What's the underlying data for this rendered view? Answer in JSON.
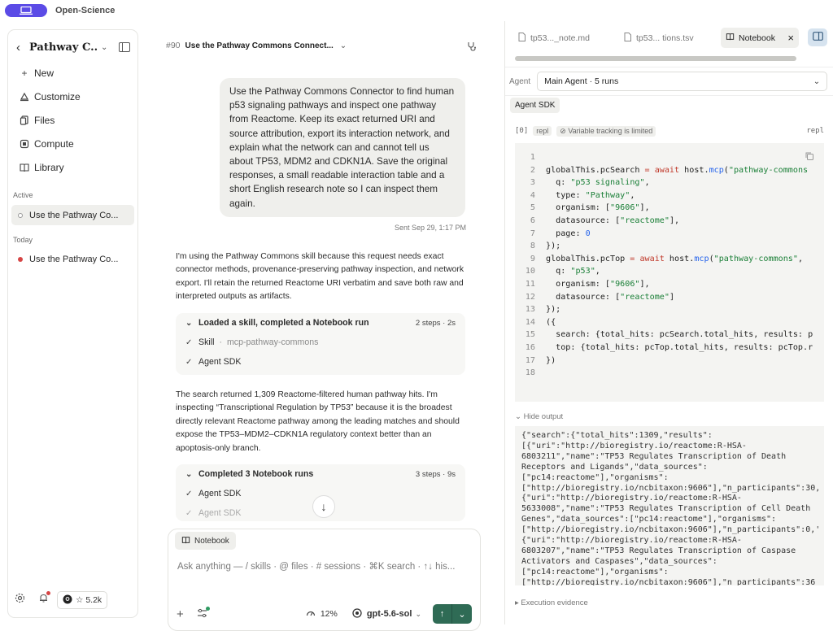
{
  "app": {
    "name": "Open-Science"
  },
  "sidebar": {
    "title": "Pathway C...",
    "nav": [
      {
        "label": "New",
        "icon": "plus-icon"
      },
      {
        "label": "Customize",
        "icon": "palette-icon"
      },
      {
        "label": "Files",
        "icon": "files-icon"
      },
      {
        "label": "Compute",
        "icon": "compute-icon"
      },
      {
        "label": "Library",
        "icon": "book-icon"
      }
    ],
    "active_label": "Active",
    "active_thread": "Use the Pathway Co...",
    "today_label": "Today",
    "today_thread": "Use the Pathway Co...",
    "github_stars": "☆ 5.2k",
    "status_color": "#d64545"
  },
  "chat": {
    "number": "#90",
    "title": "Use the Pathway Commons Connect...",
    "user_message": "Use the Pathway Commons Connector to find human p53 signaling pathways and inspect one pathway from Reactome. Keep its exact returned URI and source attribution, export its interaction network, and explain what the network can and cannot tell us about TP53, MDM2 and CDKN1A. Save the original responses, a small readable interaction table and a short English research note so I can inspect them again.",
    "sent": "Sent Sep 29, 1:17 PM",
    "assistant_1": "I'm using the Pathway Commons skill because this request needs exact connector methods, provenance-preserving pathway inspection, and network export. I'll retain the returned Reactome URI verbatim and save both raw and interpreted outputs as artifacts.",
    "steps_1": {
      "title": "Loaded a skill, completed a Notebook run",
      "meta": "2 steps · 2s",
      "items": [
        {
          "label": "Skill",
          "detail": "mcp-pathway-commons"
        },
        {
          "label": "Agent SDK",
          "detail": ""
        }
      ]
    },
    "assistant_2": "The search returned 1,309 Reactome-filtered human pathway hits. I'm inspecting “Transcriptional Regulation by TP53” because it is the broadest directly relevant Reactome pathway among the leading matches and should expose the TP53–MDM2–CDKN1A regulatory context better than an apoptosis-only branch.",
    "steps_2": {
      "title": "Completed 3 Notebook runs",
      "meta": "3 steps · 9s",
      "items": [
        {
          "label": "Agent SDK"
        },
        {
          "label": "Agent SDK"
        }
      ]
    }
  },
  "composer": {
    "chip": "Notebook",
    "placeholder": "Ask anything — / skills · @ files · # sessions · ⌘K search · ↑↓ his...",
    "context": "12%",
    "model": "gpt-5.6-sol"
  },
  "right_panel": {
    "tabs": [
      {
        "label": "tp53..._note.md"
      },
      {
        "label": "tp53... tions.tsv"
      },
      {
        "label": "Notebook"
      }
    ],
    "agent_label": "Agent",
    "agent_value": "Main Agent · 5 runs",
    "sdk_chip": "Agent SDK",
    "cell_index": "[0]",
    "cell_tag": "repl",
    "cell_note": "Variable tracking is limited",
    "cell_lang": "repl",
    "code": [
      "",
      "globalThis.pcSearch = await host.mcp(\"pathway-commons",
      "  q: \"p53 signaling\",",
      "  type: \"Pathway\",",
      "  organism: [\"9606\"],",
      "  datasource: [\"reactome\"],",
      "  page: 0",
      "});",
      "globalThis.pcTop = await host.mcp(\"pathway-commons\",",
      "  q: \"p53\",",
      "  organism: [\"9606\"],",
      "  datasource: [\"reactome\"]",
      "});",
      "({",
      "  search: {total_hits: pcSearch.total_hits, results: p",
      "  top: {total_hits: pcTop.total_hits, results: pcTop.r",
      "})",
      ""
    ],
    "hide_output": "Hide output",
    "output": [
      "{\"search\":{\"total_hits\":1309,\"results\":",
      "[{\"uri\":\"http://bioregistry.io/reactome:R-HSA-",
      "6803211\",\"name\":\"TP53 Regulates Transcription of Death",
      "Receptors and Ligands\",\"data_sources\":",
      "[\"pc14:reactome\"],\"organisms\":",
      "[\"http://bioregistry.io/ncbitaxon:9606\"],\"n_participants\":30,",
      "{\"uri\":\"http://bioregistry.io/reactome:R-HSA-",
      "5633008\",\"name\":\"TP53 Regulates Transcription of Cell Death",
      "Genes\",\"data_sources\":[\"pc14:reactome\"],\"organisms\":",
      "[\"http://bioregistry.io/ncbitaxon:9606\"],\"n_participants\":0,'",
      "{\"uri\":\"http://bioregistry.io/reactome:R-HSA-",
      "6803207\",\"name\":\"TP53 Regulates Transcription of Caspase",
      "Activators and Caspases\",\"data_sources\":",
      "[\"pc14:reactome\"],\"organisms\":",
      "[\"http://bioregistry.io/ncbitaxon:9606\"],\"n_participants\":36"
    ],
    "execution_evidence": "Execution evidence"
  }
}
